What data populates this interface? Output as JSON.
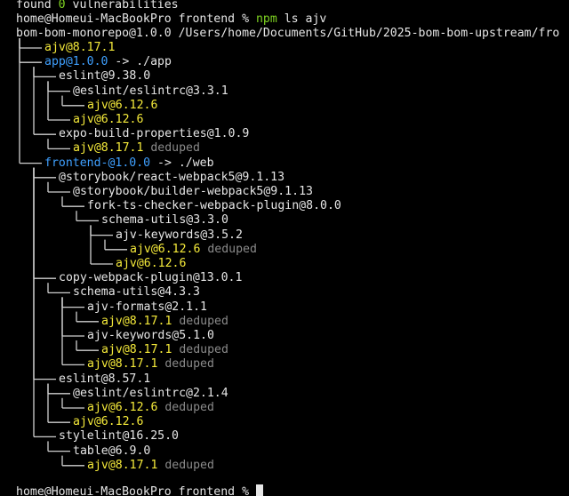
{
  "colors": {
    "background": "#000000",
    "text": "#e6e6e6",
    "green": "#7ed321",
    "yellow": "#f5ea3a",
    "blue": "#3fa0ff",
    "dim": "#8a8a8a",
    "tree_lines": "#d0d0d0"
  },
  "vuln_line": {
    "prefix": "found ",
    "count": "0",
    "suffix": " vulnerabilities"
  },
  "command": {
    "prompt": "home@Homeui-MacBookPro frontend % ",
    "cmd": "npm",
    "args": " ls ajv"
  },
  "root_line": "bom-bom-monorepo@1.0.0 /Users/home/Documents/GitHub/2025-bom-bom-upstream/fro",
  "tree": [
    {
      "depth": 1,
      "text": "ajv@8.17.1",
      "style": "yellow",
      "note": "",
      "suffix": ""
    },
    {
      "depth": 1,
      "text": "app@1.0.0",
      "style": "blue",
      "note": "",
      "suffix": " -> ./app"
    },
    {
      "depth": 2,
      "text": "eslint@9.38.0",
      "style": "white",
      "note": "",
      "suffix": ""
    },
    {
      "depth": 3,
      "text": "@eslint/eslintrc@3.3.1",
      "style": "white",
      "note": "",
      "suffix": ""
    },
    {
      "depth": 4,
      "text": "ajv@6.12.6",
      "style": "yellow",
      "note": "",
      "suffix": ""
    },
    {
      "depth": 3,
      "text": "ajv@6.12.6",
      "style": "yellow",
      "note": "",
      "suffix": ""
    },
    {
      "depth": 2,
      "text": "expo-build-properties@1.0.9",
      "style": "white",
      "note": "",
      "suffix": ""
    },
    {
      "depth": 3,
      "text": "ajv@8.17.1",
      "style": "yellow",
      "note": " deduped",
      "suffix": ""
    },
    {
      "depth": 1,
      "text": "frontend-@1.0.0",
      "style": "blue",
      "note": "",
      "suffix": " -> ./web"
    },
    {
      "depth": 2,
      "text": "@storybook/react-webpack5@9.1.13",
      "style": "white",
      "note": "",
      "suffix": ""
    },
    {
      "depth": 3,
      "text": "@storybook/builder-webpack5@9.1.13",
      "style": "white",
      "note": "",
      "suffix": ""
    },
    {
      "depth": 4,
      "text": "fork-ts-checker-webpack-plugin@8.0.0",
      "style": "white",
      "note": "",
      "suffix": ""
    },
    {
      "depth": 5,
      "text": "schema-utils@3.3.0",
      "style": "white",
      "note": "",
      "suffix": ""
    },
    {
      "depth": 6,
      "text": "ajv-keywords@3.5.2",
      "style": "white",
      "note": "",
      "suffix": ""
    },
    {
      "depth": 7,
      "text": "ajv@6.12.6",
      "style": "yellow",
      "note": " deduped",
      "suffix": ""
    },
    {
      "depth": 6,
      "text": "ajv@6.12.6",
      "style": "yellow",
      "note": "",
      "suffix": ""
    },
    {
      "depth": 2,
      "text": "copy-webpack-plugin@13.0.1",
      "style": "white",
      "note": "",
      "suffix": ""
    },
    {
      "depth": 3,
      "text": "schema-utils@4.3.3",
      "style": "white",
      "note": "",
      "suffix": ""
    },
    {
      "depth": 4,
      "text": "ajv-formats@2.1.1",
      "style": "white",
      "note": "",
      "suffix": ""
    },
    {
      "depth": 5,
      "text": "ajv@8.17.1",
      "style": "yellow",
      "note": " deduped",
      "suffix": ""
    },
    {
      "depth": 4,
      "text": "ajv-keywords@5.1.0",
      "style": "white",
      "note": "",
      "suffix": ""
    },
    {
      "depth": 5,
      "text": "ajv@8.17.1",
      "style": "yellow",
      "note": " deduped",
      "suffix": ""
    },
    {
      "depth": 4,
      "text": "ajv@8.17.1",
      "style": "yellow",
      "note": " deduped",
      "suffix": ""
    },
    {
      "depth": 2,
      "text": "eslint@8.57.1",
      "style": "white",
      "note": "",
      "suffix": ""
    },
    {
      "depth": 3,
      "text": "@eslint/eslintrc@2.1.4",
      "style": "white",
      "note": "",
      "suffix": ""
    },
    {
      "depth": 4,
      "text": "ajv@6.12.6",
      "style": "yellow",
      "note": " deduped",
      "suffix": ""
    },
    {
      "depth": 3,
      "text": "ajv@6.12.6",
      "style": "yellow",
      "note": "",
      "suffix": ""
    },
    {
      "depth": 2,
      "text": "stylelint@16.25.0",
      "style": "white",
      "note": "",
      "suffix": ""
    },
    {
      "depth": 3,
      "text": "table@6.9.0",
      "style": "white",
      "note": "",
      "suffix": ""
    },
    {
      "depth": 4,
      "text": "ajv@8.17.1",
      "style": "yellow",
      "note": " deduped",
      "suffix": ""
    }
  ],
  "final_prompt": "home@Homeui-MacBookPro frontend % "
}
